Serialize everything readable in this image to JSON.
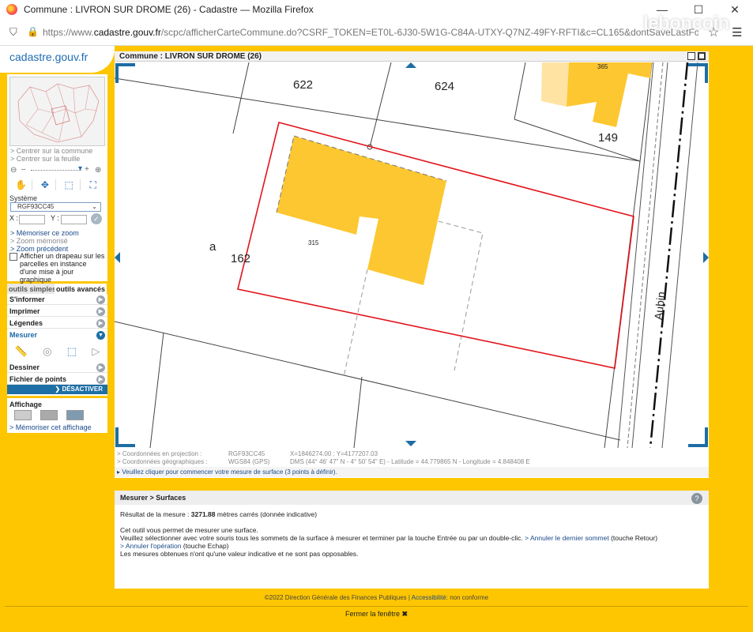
{
  "browser": {
    "window_title": "Commune : LIVRON SUR DROME (26) - Cadastre — Mozilla Firefox",
    "url_prefix": "https://www.",
    "url_domain": "cadastre.gouv.fr",
    "url_rest": "/scpc/afficherCarteCommune.do?CSRF_TOKEN=ET0L-6J30-5W1G-C84A-UTXY-Q7NZ-49FY-RFTI&c=CL165&dontSaveLastForward&keepVolatileSession=",
    "watermark": "leboncoin"
  },
  "site": {
    "logo": "cadastre.gouv.fr"
  },
  "left_panel": {
    "center_commune": "> Centrer sur la commune",
    "center_sheet": "> Centrer sur la feuille",
    "system_label": "Système",
    "system_value": "RGF93CC45",
    "x_label": "X :",
    "y_label": "Y :",
    "memorize_zoom": "> Mémoriser ce zoom",
    "zoom_memorized": "> Zoom mémorisé",
    "previous_zoom": "> Zoom précédent",
    "flag_text": "Afficher un drapeau sur les parcelles en instance d'une mise à jour graphique"
  },
  "tabs": {
    "simple": "outils simples",
    "advanced": "outils avancés"
  },
  "menu": {
    "inform": "S'informer",
    "print": "Imprimer",
    "legends": "Légendes",
    "measure": "Mesurer",
    "draw": "Dessiner",
    "points_file": "Fichier de points",
    "deactivate": "DÉSACTIVER"
  },
  "affichage": {
    "title": "Affichage",
    "memorize": "> Mémoriser cet affichage"
  },
  "map": {
    "header": "Commune : LIVRON SUR DROME (26)",
    "labels": {
      "p622": "622",
      "p624": "624",
      "p365": "365",
      "p149": "149",
      "p315": "315",
      "p162": "162",
      "section": "a",
      "street": "Aubin"
    }
  },
  "coords": {
    "proj_label": "> Coordonnées en projection :",
    "proj_system": "RGF93CC45",
    "proj_value": "X=1846274.00 : Y=4177207.03",
    "geo_label": "> Coordonnées géographiques :",
    "geo_system": "WGS84 (GPS)",
    "geo_value": "DMS (44° 46' 47\" N - 4° 50' 54\" E) - Latitude = 44.779865 N - Longitude = 4.848408 E"
  },
  "hint": "▸ Veuillez cliquer pour commencer votre mesure de surface (3 points à définir).",
  "result": {
    "title": "Mesurer > Surfaces",
    "measure_prefix": "Résultat de la mesure :",
    "measure_value": "3271.88",
    "measure_suffix": "mètres carrés (donnée indicative)",
    "line1": "Cet outil vous permet de mesurer une surface.",
    "line2": "Veuillez sélectionner avec votre souris tous les sommets de la surface à mesurer et terminer par la touche Entrée ou par un double-clic.",
    "cancel_last": "> Annuler le dernier sommet",
    "cancel_last_key": "(touche Retour)",
    "cancel_op": "> Annuler l'opération",
    "cancel_op_key": "(touche Echap)",
    "line3": "Les mesures obtenues n'ont qu'une valeur indicative et ne sont pas opposables."
  },
  "footer": {
    "copyright": "©2022 Direction Générale des Finances Publiques",
    "sep": "|",
    "accessibility_label": "Accessibilité",
    "accessibility_value": ": non conforme",
    "close": "Fermer la fenêtre"
  },
  "colors": {
    "accent": "#fec600",
    "building": "#fdc731",
    "building_light": "#fee3a3",
    "measure": "#e2141b",
    "link": "#1a4a8a"
  }
}
